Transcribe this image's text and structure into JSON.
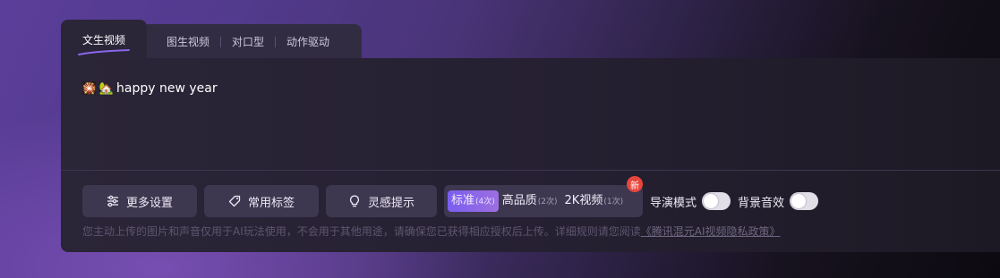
{
  "tabs": {
    "active": "文生视频",
    "others": [
      "图生视频",
      "对口型",
      "动作驱动"
    ]
  },
  "prompt": {
    "emoji_1": "🎇",
    "emoji_2": "🏡",
    "text": "happy new year"
  },
  "toolbar": {
    "more_settings": "更多设置",
    "common_tags": "常用标签",
    "inspiration": "灵感提示"
  },
  "quality": {
    "options": [
      {
        "label": "标准",
        "count": "(4次)",
        "selected": true
      },
      {
        "label": "高品质",
        "count": "(2次)",
        "selected": false
      },
      {
        "label": "2K视频",
        "count": "(1次)",
        "selected": false
      }
    ],
    "badge": "新"
  },
  "toggles": {
    "director_mode": {
      "label": "导演模式",
      "on": false
    },
    "bg_sound": {
      "label": "背景音效",
      "on": false
    }
  },
  "notice": {
    "text": "您主动上传的图片和声音仅用于AI玩法使用，不会用于其他用途，请确保您已获得相应授权后上传。详细规则请您阅读",
    "link": "《腾讯混元AI视频隐私政策》"
  },
  "colors": {
    "accent": "#8a66ea",
    "badge": "#e8463d",
    "panel": "#2a2537"
  }
}
